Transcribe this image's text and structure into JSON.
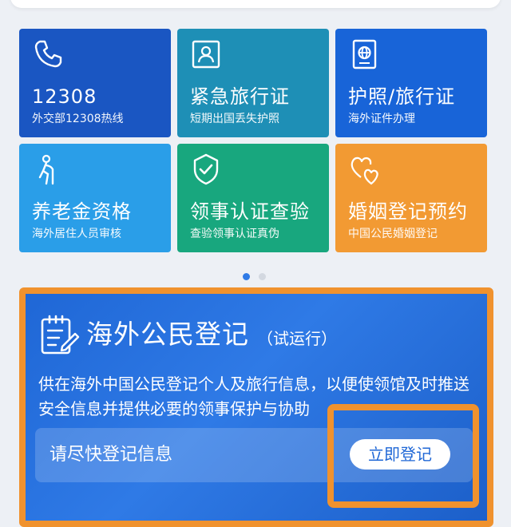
{
  "tiles": [
    {
      "title": "12308",
      "subtitle": "外交部12308热线",
      "icon": "phone-icon",
      "color": "#1a56c2"
    },
    {
      "title": "紧急旅行证",
      "subtitle": "短期出国丢失护照",
      "icon": "id-card-icon",
      "color": "#1e8fb6"
    },
    {
      "title": "护照/旅行证",
      "subtitle": "海外证件办理",
      "icon": "passport-icon",
      "color": "#1864d8"
    },
    {
      "title": "养老金资格",
      "subtitle": "海外居住人员审核",
      "icon": "elderly-person-icon",
      "color": "#2a9ee8"
    },
    {
      "title": "领事认证查验",
      "subtitle": "查验领事认证真伪",
      "icon": "shield-check-icon",
      "color": "#18a77e"
    },
    {
      "title": "婚姻登记预约",
      "subtitle": "中国公民婚姻登记",
      "icon": "hearts-icon",
      "color": "#f29a33"
    }
  ],
  "carousel": {
    "page_count": 2,
    "active_index": 0
  },
  "register": {
    "title": "海外公民登记",
    "trial_label": "（试运行）",
    "description": "供在海外中国公民登记个人及旅行信息，以便使领馆及时推送安全信息并提供必要的领事保护与协助",
    "prompt": "请尽快登记信息",
    "button_label": "立即登记",
    "icon": "form-edit-icon"
  },
  "colors": {
    "highlight": "#f0922e",
    "panel": "#1f67d6"
  }
}
